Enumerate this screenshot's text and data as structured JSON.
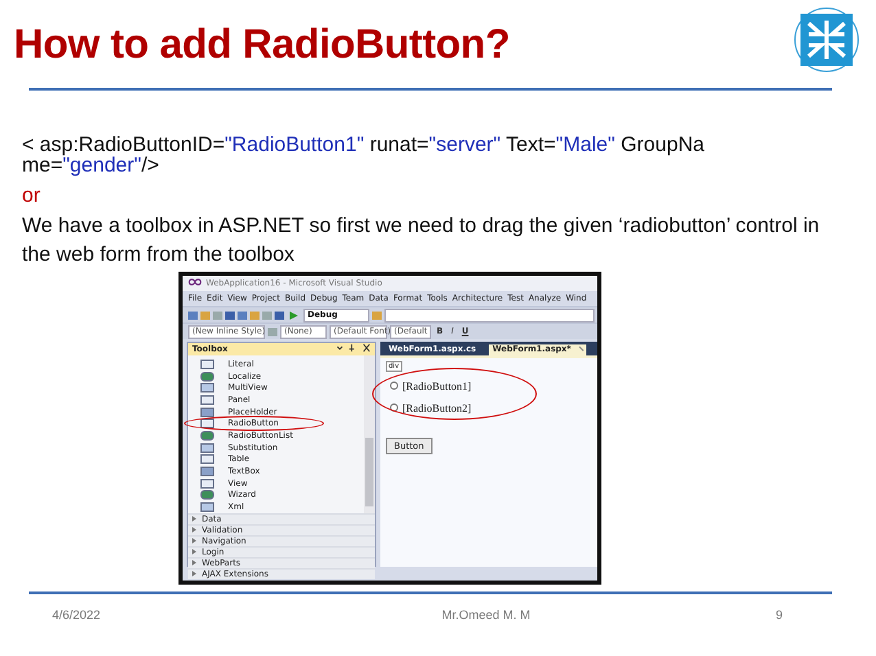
{
  "slide": {
    "title": "How to add RadioButton?"
  },
  "code_line": [
    {
      "kind": "plain",
      "text": "< asp:RadioButtonID="
    },
    {
      "kind": "string",
      "text": "\"RadioButton1\""
    },
    {
      "kind": "plain",
      "text": " runat="
    },
    {
      "kind": "string",
      "text": "\"server\""
    },
    {
      "kind": "plain",
      "text": " Text="
    },
    {
      "kind": "string",
      "text": "\"Male\""
    },
    {
      "kind": "plain",
      "text": " GroupNa me="
    },
    {
      "kind": "string",
      "text": "\"gender\""
    },
    {
      "kind": "plain",
      "text": "/>"
    }
  ],
  "separator": "or",
  "paragraph": "We have a toolbox in ASP.NET so first we need to drag the given ‘radiobutton’ control in the web form from the toolbox",
  "screenshot": {
    "window_title": "WebApplication16 - Microsoft Visual Studio",
    "menu": [
      "File",
      "Edit",
      "View",
      "Project",
      "Build",
      "Debug",
      "Team",
      "Data",
      "Format",
      "Tools",
      "Architecture",
      "Test",
      "Analyze",
      "Wind"
    ],
    "toolbar": {
      "configuration": "Debug"
    },
    "format_bar": {
      "style": "(New Inline Style)",
      "target": "(None)",
      "font": "(Default Font)",
      "size": "(Default",
      "buttons": [
        "B",
        "I",
        "U"
      ]
    },
    "toolbox": {
      "title": "Toolbox",
      "items": [
        {
          "label": "Literal",
          "circled": false
        },
        {
          "label": "Localize",
          "circled": false
        },
        {
          "label": "MultiView",
          "circled": false
        },
        {
          "label": "Panel",
          "circled": false
        },
        {
          "label": "PlaceHolder",
          "circled": false
        },
        {
          "label": "RadioButton",
          "circled": true
        },
        {
          "label": "RadioButtonList",
          "circled": false
        },
        {
          "label": "Substitution",
          "circled": false
        },
        {
          "label": "Table",
          "circled": false
        },
        {
          "label": "TextBox",
          "circled": false
        },
        {
          "label": "View",
          "circled": false
        },
        {
          "label": "Wizard",
          "circled": false
        },
        {
          "label": "Xml",
          "circled": false
        }
      ],
      "categories": [
        "Data",
        "Validation",
        "Navigation",
        "Login",
        "WebParts",
        "AJAX Extensions"
      ]
    },
    "tabs": [
      {
        "label": "WebForm1.aspx.cs",
        "selected": false
      },
      {
        "label": "WebForm1.aspx*",
        "selected": true
      }
    ],
    "design": {
      "tag": "div",
      "radios_circled": true,
      "radios": [
        {
          "label": "[RadioButton1]",
          "checked": false
        },
        {
          "label": "[RadioButton2]",
          "checked": false
        }
      ],
      "button": "Button"
    }
  },
  "footer": {
    "date": "4/6/2022",
    "author": "Mr.Omeed M. M",
    "page": "9"
  }
}
